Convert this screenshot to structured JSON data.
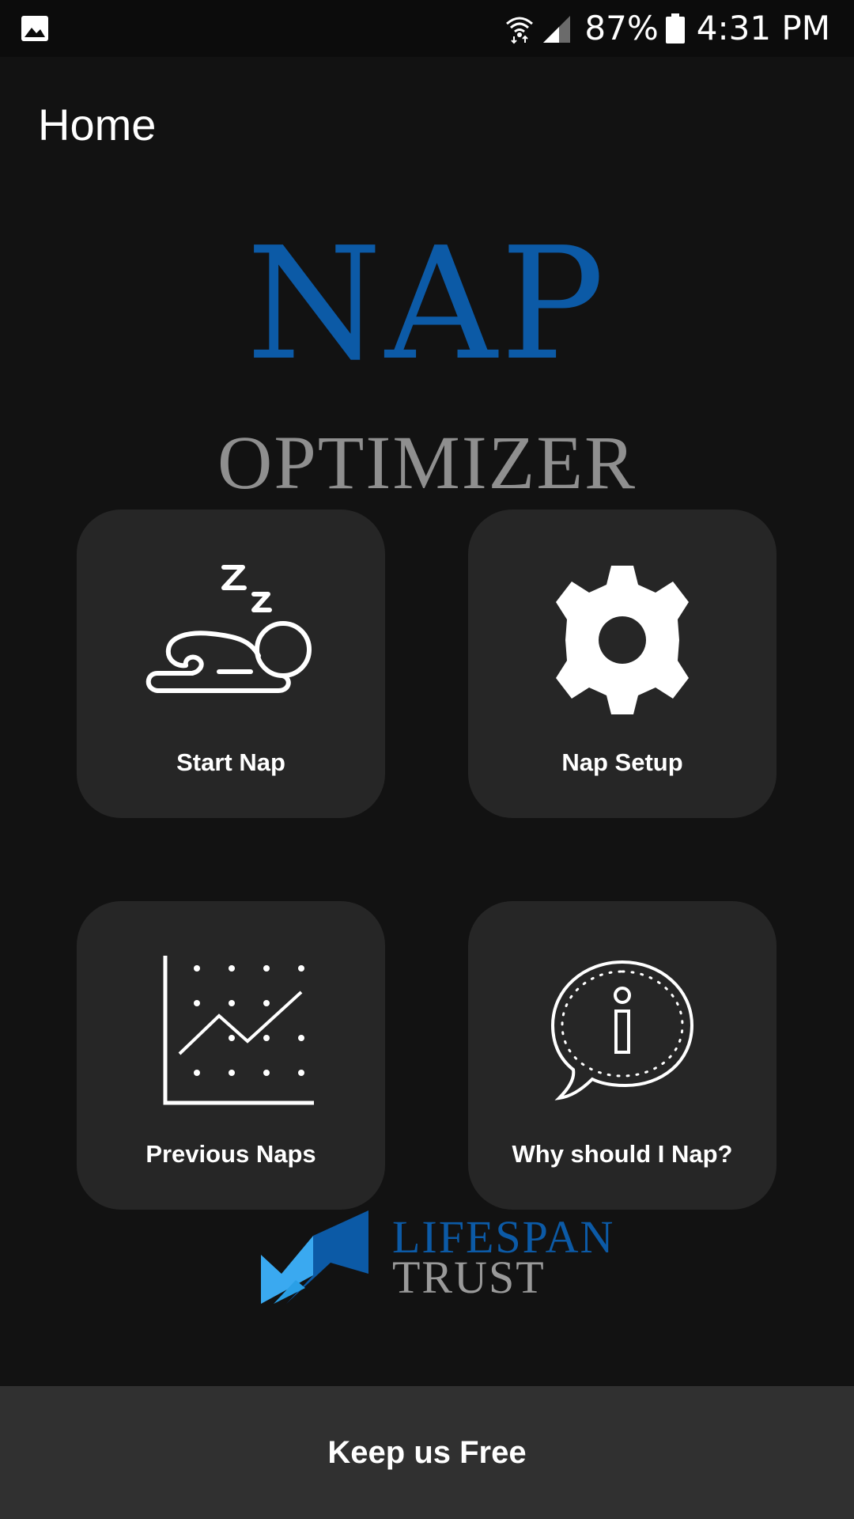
{
  "status_bar": {
    "battery": "87%",
    "time": "4:31 PM",
    "icons": [
      "gallery-icon",
      "wifi-icon",
      "cell-signal-icon",
      "battery-icon"
    ]
  },
  "header": {
    "title": "Home"
  },
  "logo": {
    "line1": "NAP",
    "line2": "OPTIMIZER",
    "line1_color": "#0c5aa6",
    "line2_color": "#8f8f8f"
  },
  "tiles": [
    {
      "label": "Start Nap",
      "icon": "sleeping-baby-icon"
    },
    {
      "label": "Nap Setup",
      "icon": "gear-icon"
    },
    {
      "label": "Previous Naps",
      "icon": "line-chart-icon"
    },
    {
      "label": "Why should I Nap?",
      "icon": "info-speech-bubble-icon"
    }
  ],
  "sponsor": {
    "line1": "LIFESPAN",
    "line2": "TRUST",
    "icon": "lifespan-trust-logo-icon",
    "accent": "#2a9fe6"
  },
  "bottom_bar": {
    "label": "Keep us Free"
  },
  "colors": {
    "background": "#121212",
    "tile": "#262626",
    "bottom_bar": "#303030"
  }
}
